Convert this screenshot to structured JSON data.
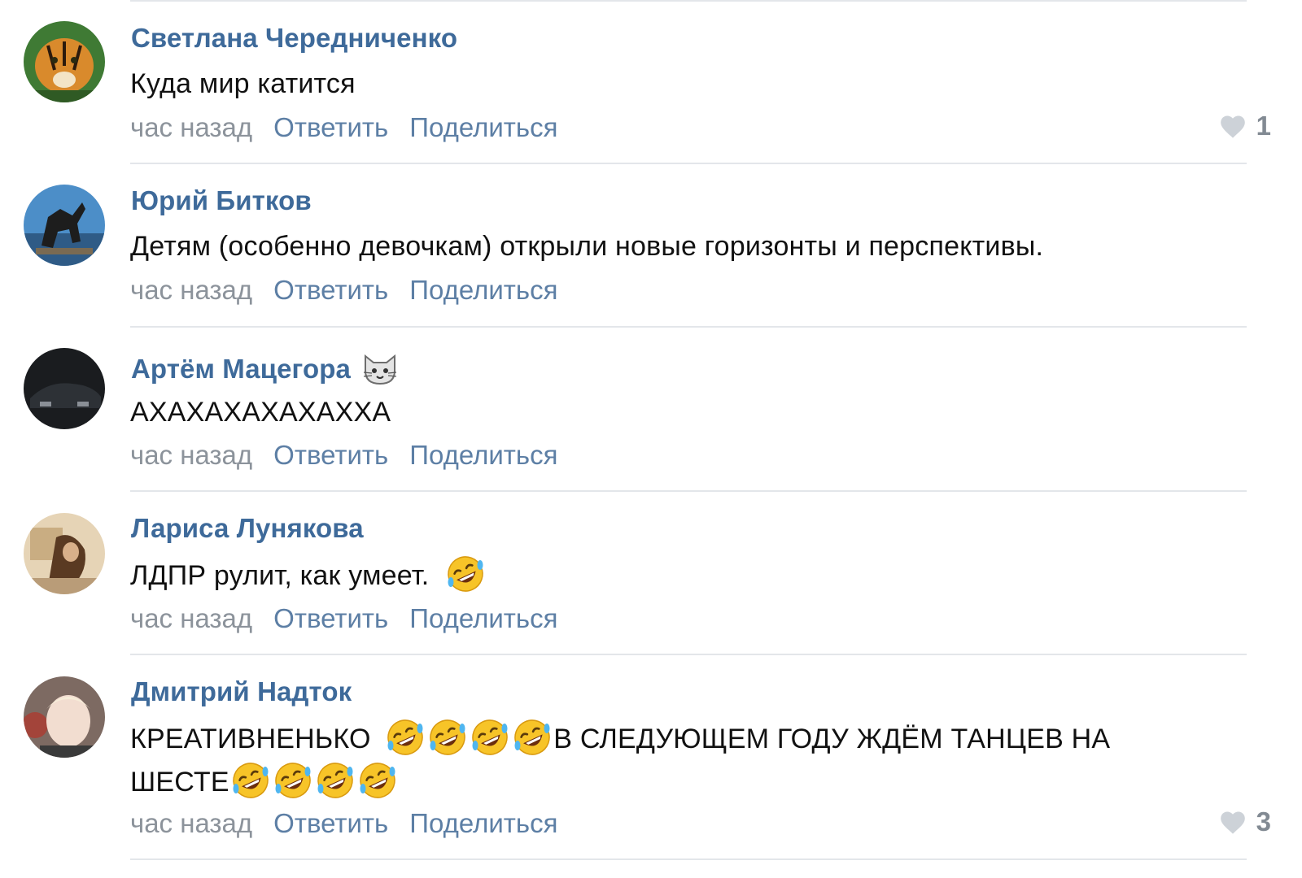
{
  "comments": [
    {
      "author": "Светлана Чередниченко",
      "text": "Куда мир катится",
      "time": "час назад",
      "reply": "Ответить",
      "share": "Поделиться",
      "likes": "1"
    },
    {
      "author": "Юрий Битков",
      "text": "Детям (особенно девочкам) открыли новые горизонты и перспективы.",
      "time": "час назад",
      "reply": "Ответить",
      "share": "Поделиться"
    },
    {
      "author": "Артём Мацегора",
      "author_icon": "cat-face-icon",
      "text": "АХАХАХАХАХАХХА",
      "time": "час назад",
      "reply": "Ответить",
      "share": "Поделиться"
    },
    {
      "author": "Лариса Лунякова",
      "text": "ЛДПР рулит, как умеет.",
      "emoji": "rolling-on-floor-laughing-icon",
      "time": "час назад",
      "reply": "Ответить",
      "share": "Поделиться"
    },
    {
      "author": "Дмитрий Надток",
      "text_part1": "КРЕАТИВНЕНЬКО",
      "text_part2": "В СЛЕДУЮЩЕМ ГОДУ ЖДЁМ ТАНЦЕВ НА ШЕСТЕ",
      "emoji": "rolling-on-floor-laughing-icon",
      "time": "час назад",
      "reply": "Ответить",
      "share": "Поделиться",
      "likes": "3"
    }
  ],
  "colors": {
    "author": "#3e6a9a",
    "action": "#5d7fa5",
    "time": "#8c939b",
    "divider": "#e3e6ea"
  }
}
